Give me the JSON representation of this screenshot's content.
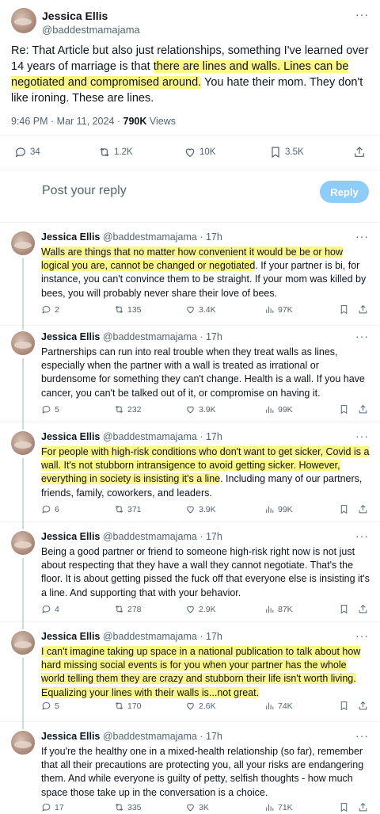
{
  "main_post": {
    "author_name": "Jessica Ellis",
    "author_handle": "@baddestmamajama",
    "more_label": "···",
    "text_before": "Re: That Article but also just relationships, something I've learned over 14 years of marriage is that ",
    "text_hl1": "there are lines and walls. Lines can be negotiated and compromised around.",
    "text_after": " You hate their mom. They don't like ironing. These are lines.",
    "timestamp": "9:46 PM · Mar 11, 2024 · ",
    "views_count": "790K",
    "views_label": " Views",
    "stats": {
      "replies": "34",
      "reposts": "1.2K",
      "likes": "10K",
      "bookmarks": "3.5K"
    }
  },
  "reply_box": {
    "placeholder": "Post your reply",
    "button_label": "Reply"
  },
  "replies": [
    {
      "name": "Jessica Ellis",
      "handle": "@baddestmamajama",
      "time": "· 17h",
      "text_hl": "Walls are things that no matter how convenient it would be be or how logical you are, cannot be changed or negotiated",
      "text": ". If your partner is bi, for instance, you can't convince them to be straight. If your mom was killed by bees, you will probably never share their love of bees.",
      "replies": "2",
      "reposts": "135",
      "likes": "3.4K",
      "views": "97K"
    },
    {
      "name": "Jessica Ellis",
      "handle": "@baddestmamajama",
      "time": "· 17h",
      "text_hl": "",
      "text": "Partnerships can run into real trouble when they treat walls as lines, especially when the partner with a wall is treated as irrational or burdensome for something they can't change. Health is a wall. If you have cancer, you can't be talked out of it, or compromise on having it.",
      "replies": "5",
      "reposts": "232",
      "likes": "3.9K",
      "views": "99K"
    },
    {
      "name": "Jessica Ellis",
      "handle": "@baddestmamajama",
      "time": "· 17h",
      "text_hl": "For people with high-risk conditions who don't want to get sicker, Covid is a wall. It's not stubborn intransigence to avoid getting sicker. However, everything in society is insisting it's a line",
      "text": ". Including many of our partners, friends, family, coworkers, and leaders.",
      "replies": "6",
      "reposts": "371",
      "likes": "3.9K",
      "views": "99K"
    },
    {
      "name": "Jessica Ellis",
      "handle": "@baddestmamajama",
      "time": "· 17h",
      "text_hl": "",
      "text": "Being a good partner or friend to someone high-risk right now is not just about respecting that they have a wall they cannot negotiate. That's the floor. It is about getting pissed the fuck off that everyone else is insisting it's a line. And supporting that with your behavior.",
      "replies": "4",
      "reposts": "278",
      "likes": "2.9K",
      "views": "87K"
    },
    {
      "name": "Jessica Ellis",
      "handle": "@baddestmamajama",
      "time": "· 17h",
      "text_hl": "I can't imagine taking up space in a national publication to talk about how hard missing social events is for you when your partner has the whole world telling them they are crazy and stubborn their life isn't worth living. Equalizing your lines with their walls is...not great.",
      "text": "",
      "replies": "5",
      "reposts": "170",
      "likes": "2.6K",
      "views": "74K"
    },
    {
      "name": "Jessica Ellis",
      "handle": "@baddestmamajama",
      "time": "· 17h",
      "text_hl": "",
      "text": "If you're the healthy one in a mixed-health relationship (so far), remember that all their precautions are protecting you, all your risks are endangering them. And while everyone is guilty of petty, selfish thoughts - how much space those take up in the conversation is a choice.",
      "replies": "17",
      "reposts": "335",
      "likes": "3K",
      "views": "71K"
    }
  ]
}
